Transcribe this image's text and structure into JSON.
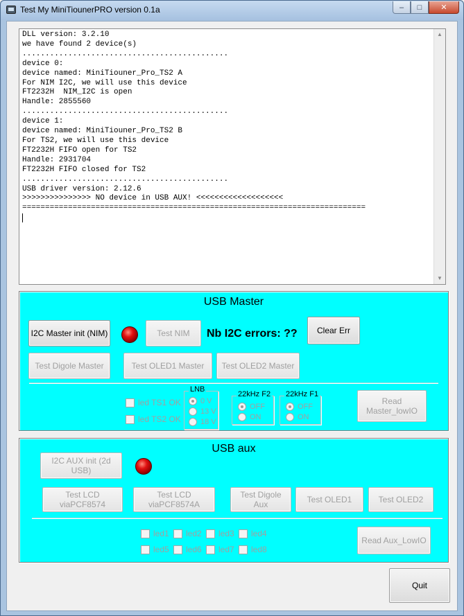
{
  "window": {
    "title": "Test My MiniTiounerPRO version 0.1a",
    "buttons": {
      "minimize": "–",
      "maximize": "□",
      "close": "✕"
    }
  },
  "log": {
    "lines": [
      "DLL version: 3.2.10",
      "we have found 2 device(s)",
      ".............................................",
      "device 0:",
      "device named: MiniTiouner_Pro_TS2 A",
      "For NIM I2C, we will use this device",
      "FT2232H  NIM_I2C is open",
      "Handle: 2855560",
      ".............................................",
      "device 1:",
      "device named: MiniTiouner_Pro_TS2 B",
      "For TS2, we will use this device",
      "FT2232H FIFO open for TS2",
      "Handle: 2931704",
      "FT2232H FIFO closed for TS2",
      ".............................................",
      "USB driver version: 2.12.6",
      ">>>>>>>>>>>>>>> NO device in USB AUX! <<<<<<<<<<<<<<<<<<<",
      "==========================================================================="
    ]
  },
  "usb_master": {
    "title": "USB Master",
    "i2c_init": "I2C Master init (NIM)",
    "test_nim": "Test NIM",
    "nb_errors_label": "Nb I2C errors:",
    "nb_errors_value": "??",
    "clear_err": "Clear Err",
    "test_digole": "Test Digole Master",
    "test_oled1": "Test OLED1 Master",
    "test_oled2": "Test OLED2 Master",
    "led_ts1": "led TS1 OK",
    "led_ts2": "led TS2 OK",
    "lnb": {
      "title": "LNB",
      "options": [
        "0 V",
        "13 V",
        "18 V"
      ]
    },
    "f2": {
      "title": "22kHz F2",
      "options": [
        "OFF",
        "ON"
      ]
    },
    "f1": {
      "title": "22kHz F1",
      "options": [
        "OFF",
        "ON"
      ]
    },
    "read_master": "Read Master_lowIO"
  },
  "usb_aux": {
    "title": "USB aux",
    "i2c_init": "I2C AUX init (2d USB)",
    "test_lcd_a": "Test LCD viaPCF8574",
    "test_lcd_b": "Test LCD viaPCF8574A",
    "test_digole": "Test Digole Aux",
    "test_oled1": "Test OLED1",
    "test_oled2": "Test OLED2",
    "leds": [
      "led1",
      "led2",
      "led3",
      "led4",
      "led5",
      "led6",
      "led7",
      "led8"
    ],
    "read_aux": "Read Aux_LowIO"
  },
  "quit": "Quit",
  "colors": {
    "panel": "#00ffff",
    "led": "#e01010"
  }
}
